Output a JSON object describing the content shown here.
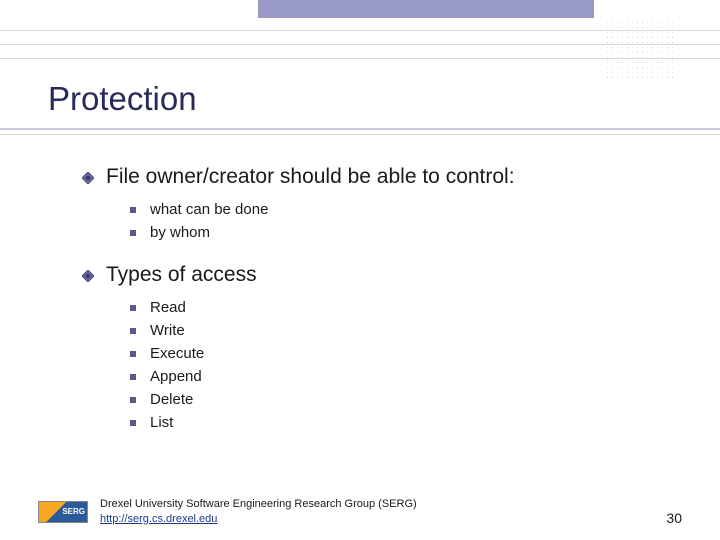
{
  "slide": {
    "title": "Protection",
    "sections": [
      {
        "heading": "File owner/creator should be able to control:",
        "items": [
          "what can be done",
          "by whom"
        ]
      },
      {
        "heading": "Types of access",
        "items": [
          "Read",
          "Write",
          "Execute",
          "Append",
          "Delete",
          "List"
        ]
      }
    ]
  },
  "footer": {
    "org": "Drexel University Software Engineering Research Group (SERG)",
    "link_prefix": "http://",
    "link_rest": "serg.cs.drexel.edu",
    "logo_text": "SERG",
    "page_number": "30"
  }
}
